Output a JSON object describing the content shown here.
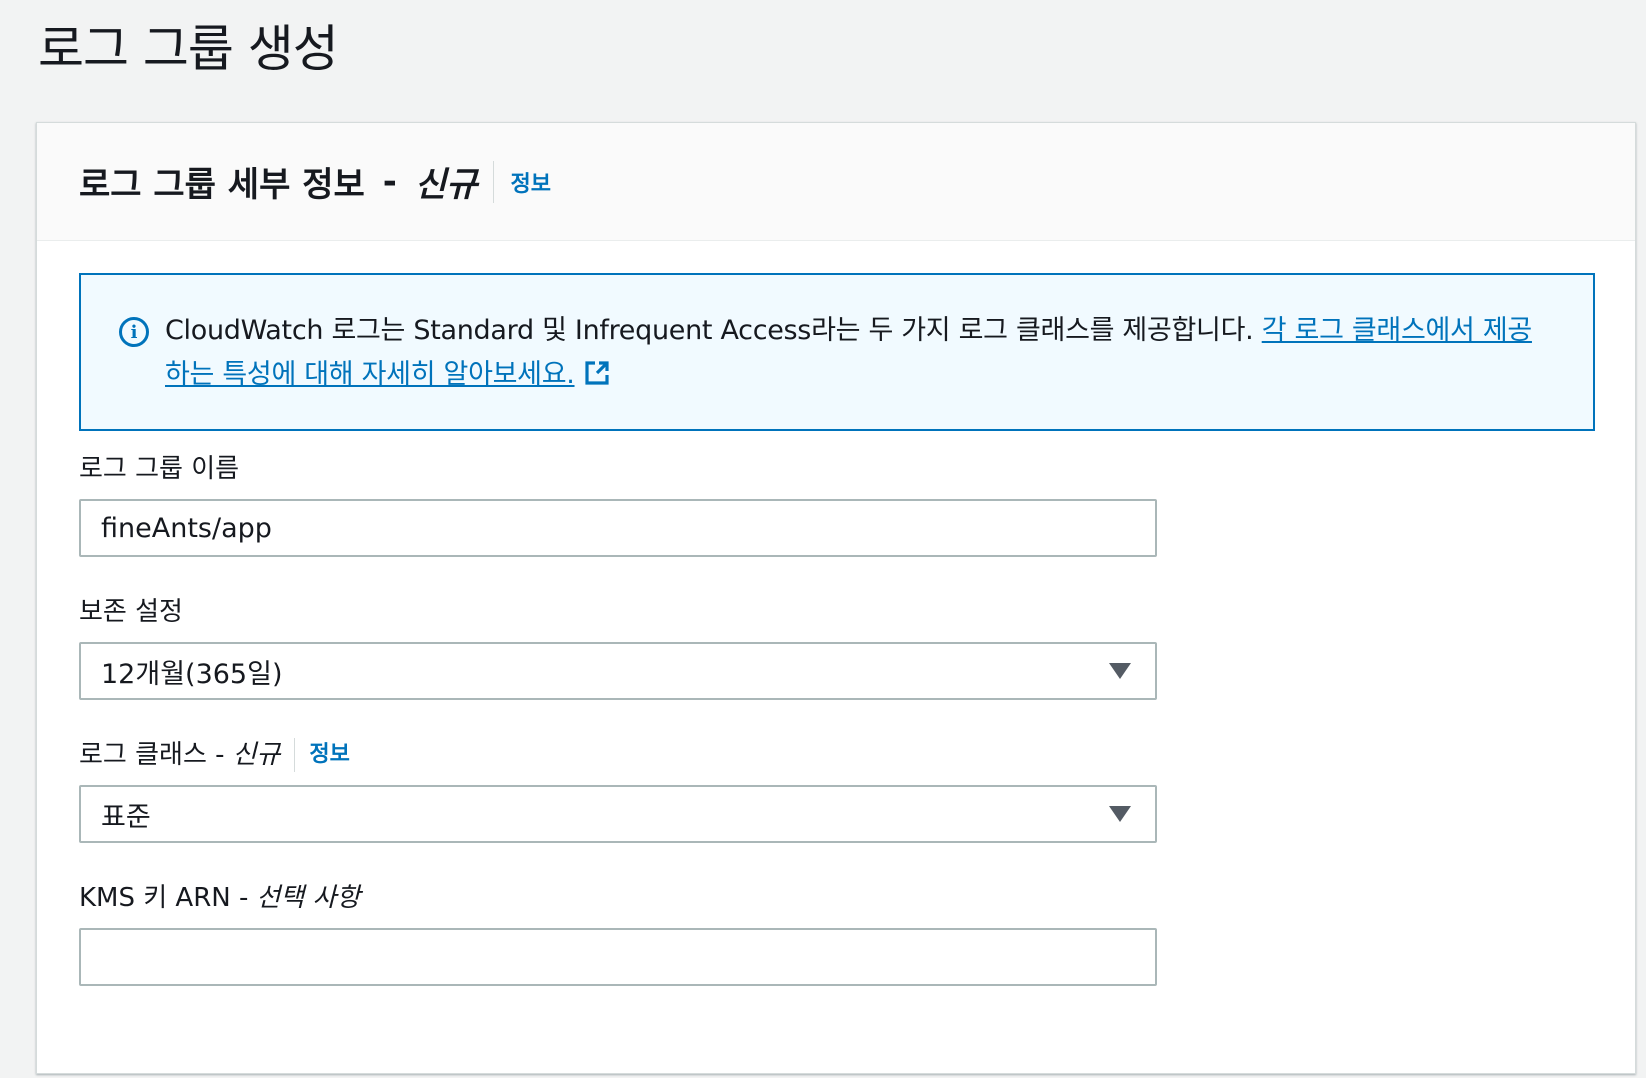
{
  "page": {
    "title": "로그 그룹 생성"
  },
  "panel": {
    "title": "로그 그룹 세부 정보",
    "title_sep": "-",
    "title_new": "신규",
    "info_label": "정보"
  },
  "alert": {
    "icon": "info-circle-icon",
    "text": "CloudWatch 로그는 Standard 및 Infrequent Access라는 두 가지 로그 클래스를 제공합니다. ",
    "link_text": "각 로그 클래스에서 제공하는 특성에 대해 자세히 알아보세요.",
    "link_icon": "external-link-icon"
  },
  "fields": {
    "name": {
      "label": "로그 그룹 이름",
      "value": "fineAnts/app"
    },
    "retention": {
      "label": "보존 설정",
      "value": "12개월(365일)"
    },
    "log_class": {
      "label": "로그 클래스 -",
      "label_new": "신규",
      "info_label": "정보",
      "value": "표준"
    },
    "kms": {
      "label": "KMS 키 ARN -",
      "label_optional": "선택 사항",
      "value": ""
    }
  },
  "colors": {
    "accent": "#0073bb",
    "background": "#f2f3f3",
    "alert_bg": "#f1faff",
    "border": "#aab7b8"
  }
}
